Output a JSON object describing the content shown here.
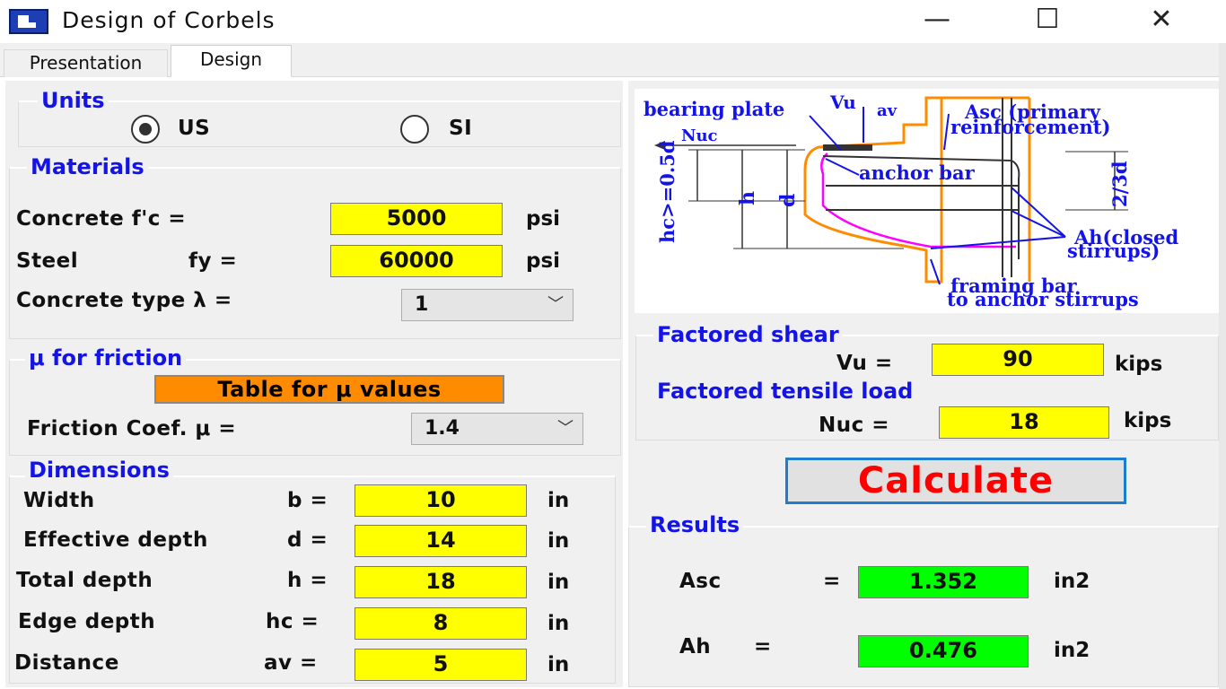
{
  "window": {
    "title": "Design of Corbels",
    "minimize": "—",
    "maximize": "☐",
    "close": "✕"
  },
  "tabs": [
    {
      "label": "Presentation",
      "active": false
    },
    {
      "label": "Design",
      "active": true
    }
  ],
  "units": {
    "title": "Units",
    "options": [
      "US",
      "SI"
    ],
    "selected": "US"
  },
  "materials": {
    "title": "Materials",
    "concrete_label": "Concrete  f'c =",
    "concrete_value": "5000",
    "concrete_unit": "psi",
    "steel_label": "Steel",
    "steel_symbol": "fy =",
    "steel_value": "60000",
    "steel_unit": "psi",
    "type_label": "Concrete type  λ =",
    "type_value": "1"
  },
  "friction": {
    "title": "μ for friction",
    "table_button": "Table for μ values",
    "coef_label": "Friction Coef.   μ =",
    "coef_value": "1.4"
  },
  "dimensions": {
    "title": "Dimensions",
    "rows": [
      {
        "label": "Width",
        "symbol": "b =",
        "value": "10",
        "unit": "in"
      },
      {
        "label": "Effective depth",
        "symbol": "d =",
        "value": "14",
        "unit": "in"
      },
      {
        "label": "Total depth",
        "symbol": "h =",
        "value": "18",
        "unit": "in"
      },
      {
        "label": "Edge depth",
        "symbol": "hc =",
        "value": "8",
        "unit": "in"
      },
      {
        "label": "Distance",
        "symbol": "av =",
        "value": "5",
        "unit": "in"
      }
    ]
  },
  "diagram": {
    "bearing_plate": "bearing plate",
    "vu": "Vu",
    "av": "av",
    "asc_line1": "Asc (primary",
    "asc_line2": "reinforcement)",
    "nuc": "Nuc",
    "he": "hc>=0.5d",
    "h": "h",
    "d": "d",
    "anchor_bar": "anchor bar",
    "two_third_d": "2/3d",
    "ah_line1": "Ah(closed",
    "ah_line2": "stirrups)",
    "framing_line1": "framing bar",
    "framing_line2": "to anchor stirrups",
    "colors": {
      "ink": "#1414e6",
      "concrete": "#ff8c00",
      "stirrup": "#ff00ff"
    }
  },
  "loads": {
    "shear_title": "Factored shear",
    "vu_label": "Vu =",
    "vu_value": "90",
    "vu_unit": "kips",
    "tensile_title": "Factored tensile load",
    "nuc_label": "Nuc =",
    "nuc_value": "18",
    "nuc_unit": "kips"
  },
  "calculate_label": "Calculate",
  "results": {
    "title": "Results",
    "asc_label": "Asc",
    "asc_eq": "=",
    "asc_value": "1.352",
    "asc_unit": "in2",
    "ah_label": "Ah",
    "ah_eq": "=",
    "ah_value": "0.476",
    "ah_unit": "in2"
  }
}
